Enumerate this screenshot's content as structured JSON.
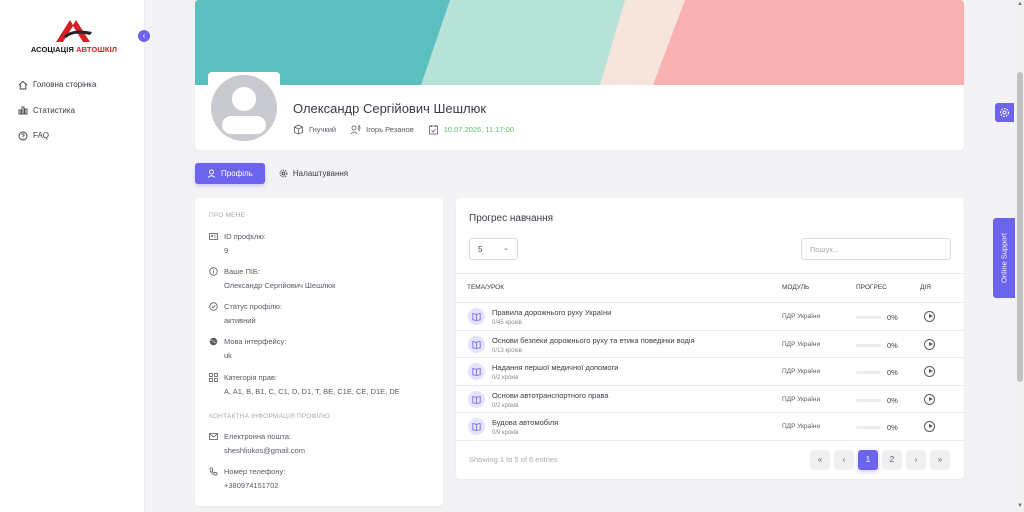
{
  "brand": {
    "logo_prefix": "АСОЦІАЦІЯ ",
    "logo_accent": "АВТОШКІЛ",
    "primary_color": "#6c63ee",
    "accent_color": "#d81f26"
  },
  "sidebar": {
    "collapse_icon": "chevron-left-icon",
    "items": [
      {
        "label": "Головна сторінка",
        "icon": "home-icon"
      },
      {
        "label": "Статистика",
        "icon": "chart-icon"
      },
      {
        "label": "FAQ",
        "icon": "help-icon"
      }
    ]
  },
  "profile": {
    "name": "Олександр Сергійович Шешлюк",
    "type": "Гнучкий",
    "instructor": "Ігорь Резанов",
    "date": "10.07.2026, 11:17:00"
  },
  "tabs": [
    {
      "label": "Профіль",
      "icon": "user-icon",
      "active": true
    },
    {
      "label": "Налаштування",
      "icon": "gear-icon",
      "active": false
    }
  ],
  "about": {
    "title": "ПРО МЕНЕ",
    "items": [
      {
        "label": "ID профілю:",
        "value": "9",
        "icon": "id-card-icon"
      },
      {
        "label": "Ваше ПІБ:",
        "value": "Олександр Сергійович Шешлюк",
        "icon": "info-icon"
      },
      {
        "label": "Статус профілю:",
        "value": "активний",
        "icon": "check-circle-icon"
      },
      {
        "label": "Мова інтерфейсу:",
        "value": "uk",
        "icon": "globe-icon"
      },
      {
        "label": "Категорія прав:",
        "value": "A, A1, B, B1, C, C1, D, D1, T, BE, C1E, CE, D1E, DE",
        "icon": "grid-icon"
      }
    ],
    "contact_title": "КОНТАКТНА ІНФОРМАЦІЯ ПРОФІЛЮ",
    "contacts": [
      {
        "label": "Електронна пошта:",
        "value": "sheshliukos@gmail.com",
        "icon": "mail-icon"
      },
      {
        "label": "Номер телефону:",
        "value": "+380974151702",
        "icon": "phone-icon"
      }
    ]
  },
  "progress": {
    "title": "Прогрес навчання",
    "page_size": "5",
    "search_placeholder": "Пошук...",
    "columns": {
      "topic": "ТЕМА/УРОК",
      "module": "МОДУЛЬ",
      "progress": "ПРОГРЕС",
      "action": "ДІЯ"
    },
    "rows": [
      {
        "name": "Правила дорожнього руху України",
        "steps": "0/45 кроків",
        "module": "ПДР України",
        "progress": 0,
        "progress_label": "0%"
      },
      {
        "name": "Основи безпеки дорожнього руху та етика поведінки водія",
        "steps": "0/13 кроків",
        "module": "ПДР України",
        "progress": 0,
        "progress_label": "0%"
      },
      {
        "name": "Надання першої медичної допомоги",
        "steps": "0/2 кроків",
        "module": "ПДР України",
        "progress": 0,
        "progress_label": "0%"
      },
      {
        "name": "Основи автотранспортного права",
        "steps": "0/2 кроків",
        "module": "ПДР України",
        "progress": 0,
        "progress_label": "0%"
      },
      {
        "name": "Будова автомобіля",
        "steps": "0/9 кроків",
        "module": "ПДР України",
        "progress": 0,
        "progress_label": "0%"
      }
    ],
    "showing": "Showing 1 to 5 of 6 entries",
    "pager": {
      "first": "«",
      "prev": "‹",
      "pages": [
        "1",
        "2"
      ],
      "next": "›",
      "last": "»",
      "current": "1"
    }
  },
  "support_label": "Online Support"
}
